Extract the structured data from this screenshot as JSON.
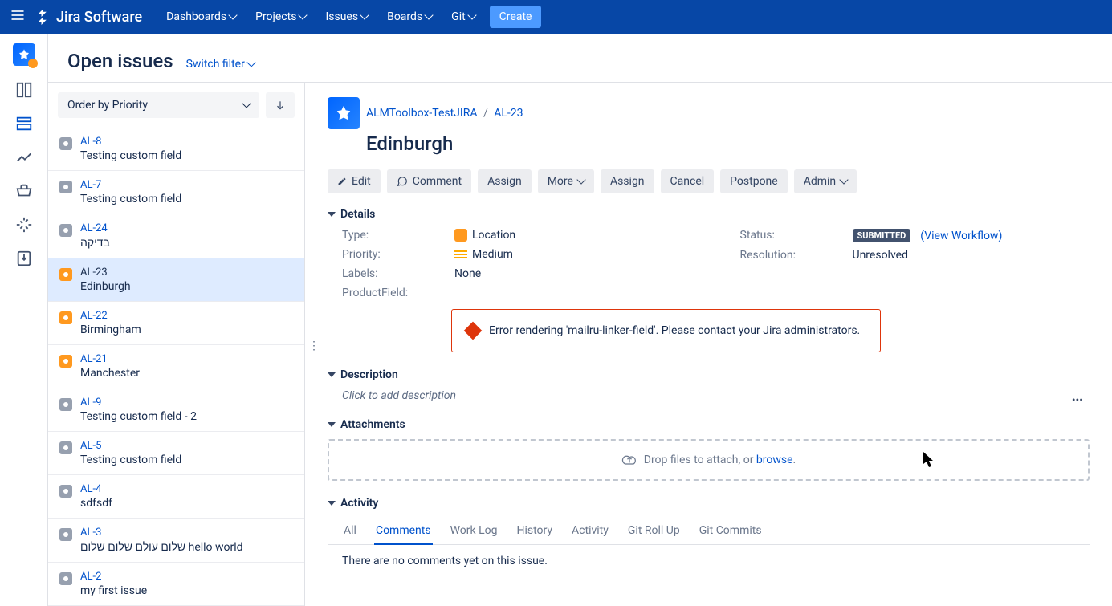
{
  "nav": {
    "product": "Jira Software",
    "items": [
      {
        "label": "Dashboards"
      },
      {
        "label": "Projects"
      },
      {
        "label": "Issues"
      },
      {
        "label": "Boards"
      },
      {
        "label": "Git"
      }
    ],
    "create": "Create"
  },
  "header": {
    "title": "Open issues",
    "switch_filter": "Switch filter"
  },
  "order": {
    "label": "Order by Priority"
  },
  "issues": [
    {
      "key": "AL-8",
      "summary": "Testing custom field",
      "icon": "gray"
    },
    {
      "key": "AL-7",
      "summary": "Testing custom field",
      "icon": "gray"
    },
    {
      "key": "AL-24",
      "summary": "בדיקה",
      "icon": "gray"
    },
    {
      "key": "AL-23",
      "summary": "Edinburgh",
      "icon": "orange",
      "selected": true
    },
    {
      "key": "AL-22",
      "summary": "Birmingham",
      "icon": "orange"
    },
    {
      "key": "AL-21",
      "summary": "Manchester",
      "icon": "orange"
    },
    {
      "key": "AL-9",
      "summary": "Testing custom field - 2",
      "icon": "gray"
    },
    {
      "key": "AL-5",
      "summary": "Testing custom field",
      "icon": "gray"
    },
    {
      "key": "AL-4",
      "summary": "sdfsdf",
      "icon": "gray"
    },
    {
      "key": "AL-3",
      "summary": "שלום עולם שלום שלום hello world",
      "icon": "gray"
    },
    {
      "key": "AL-2",
      "summary": "my first issue",
      "icon": "gray"
    }
  ],
  "detail": {
    "breadcrumb": {
      "project": "ALMToolbox-TestJIRA",
      "key": "AL-23"
    },
    "title": "Edinburgh",
    "actions": {
      "edit": "Edit",
      "comment": "Comment",
      "assign": "Assign",
      "more": "More",
      "assign2": "Assign",
      "cancel": "Cancel",
      "postpone": "Postpone",
      "admin": "Admin"
    },
    "sections": {
      "details": "Details",
      "description": "Description",
      "attachments": "Attachments",
      "activity": "Activity"
    },
    "fields": {
      "type_label": "Type:",
      "type_value": "Location",
      "priority_label": "Priority:",
      "priority_value": "Medium",
      "labels_label": "Labels:",
      "labels_value": "None",
      "productfield_label": "ProductField:",
      "status_label": "Status:",
      "status_value": "SUBMITTED",
      "status_link": "(View Workflow)",
      "resolution_label": "Resolution:",
      "resolution_value": "Unresolved"
    },
    "error": "Error rendering 'mailru-linker-field'. Please contact your Jira administrators.",
    "desc_placeholder": "Click to add description",
    "attach": {
      "text": "Drop files to attach, or ",
      "browse": "browse",
      "dot": "."
    },
    "tabs": [
      {
        "label": "All"
      },
      {
        "label": "Comments",
        "active": true
      },
      {
        "label": "Work Log"
      },
      {
        "label": "History"
      },
      {
        "label": "Activity"
      },
      {
        "label": "Git Roll Up"
      },
      {
        "label": "Git Commits"
      }
    ],
    "activity_empty": "There are no comments yet on this issue."
  }
}
